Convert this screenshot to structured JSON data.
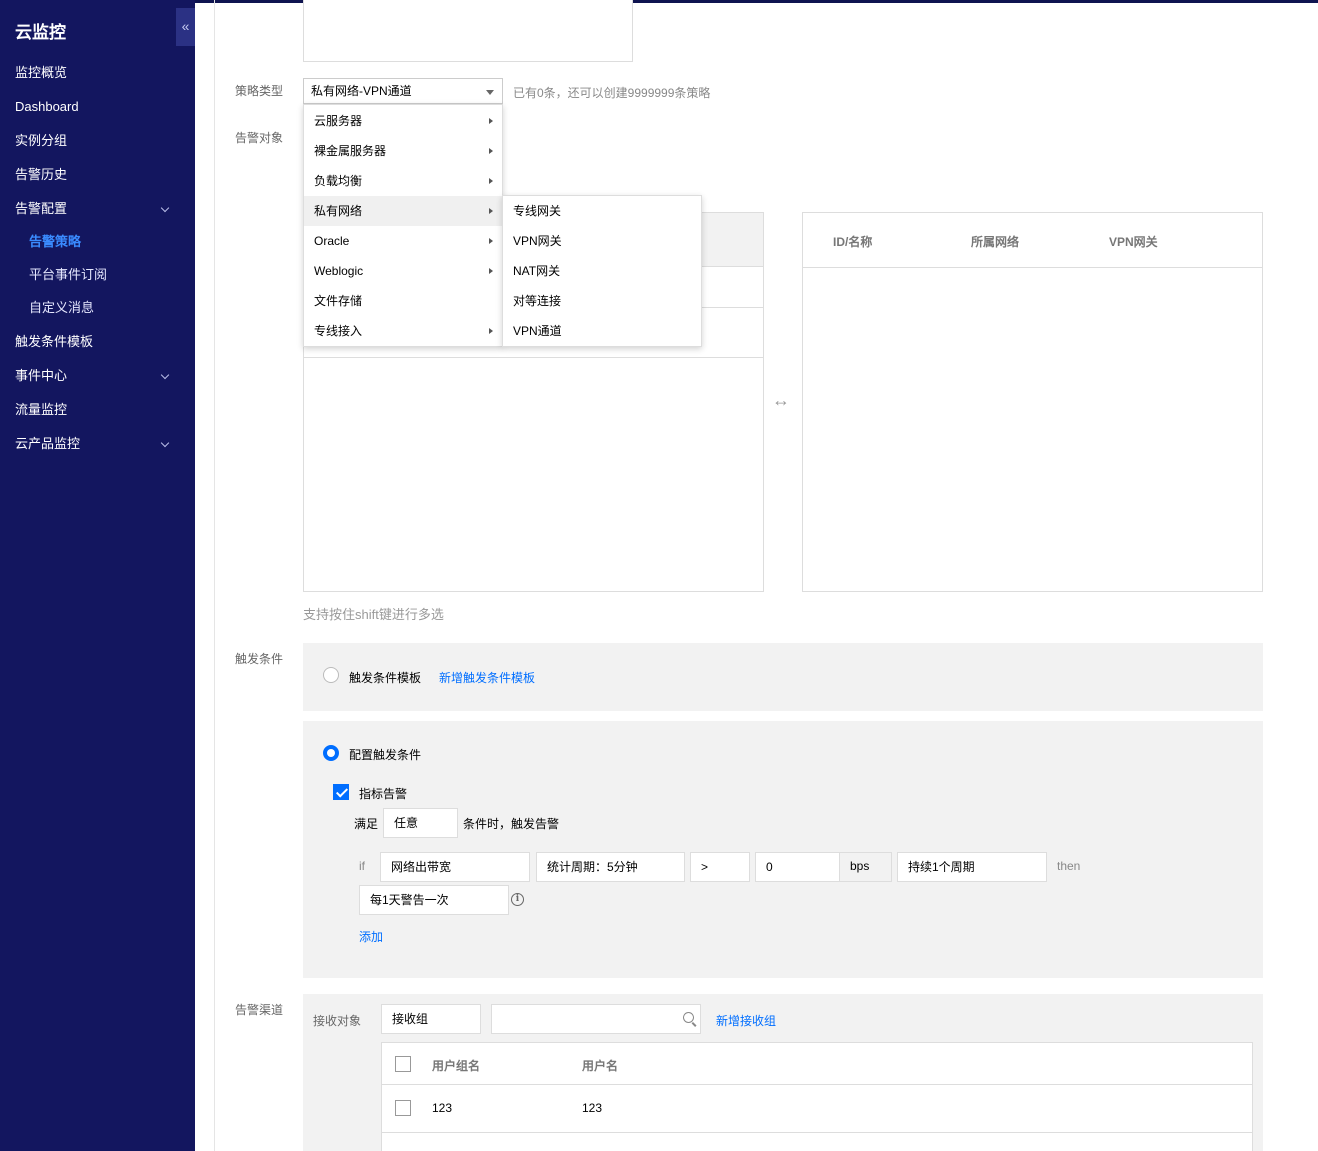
{
  "sidebar": {
    "title": "云监控",
    "collapse_glyph": "«",
    "items": [
      {
        "label": "监控概览"
      },
      {
        "label": "Dashboard"
      },
      {
        "label": "实例分组"
      },
      {
        "label": "告警历史"
      },
      {
        "label": "告警配置",
        "expandable": true
      },
      {
        "label": "告警策略",
        "sub": true,
        "active": true
      },
      {
        "label": "平台事件订阅",
        "sub": true
      },
      {
        "label": "自定义消息",
        "sub": true
      },
      {
        "label": "触发条件模板"
      },
      {
        "label": "事件中心",
        "expandable": true
      },
      {
        "label": "流量监控"
      },
      {
        "label": "云产品监控",
        "expandable": true
      }
    ]
  },
  "form": {
    "policy_type_label": "策略类型",
    "policy_type_value": "私有网络-VPN通道",
    "policy_type_hint": "已有0条，还可以创建9999999条策略",
    "alarm_object_label": "告警对象",
    "trigger_label": "触发条件",
    "channel_label": "告警渠道"
  },
  "dropdown": {
    "items": [
      {
        "label": "云服务器",
        "has_sub": true
      },
      {
        "label": "裸金属服务器",
        "has_sub": true
      },
      {
        "label": "负载均衡",
        "has_sub": true
      },
      {
        "label": "私有网络",
        "has_sub": true,
        "highlighted": true
      },
      {
        "label": "Oracle",
        "has_sub": true
      },
      {
        "label": "Weblogic",
        "has_sub": true
      },
      {
        "label": "文件存储",
        "has_sub": false
      },
      {
        "label": "专线接入",
        "has_sub": true
      }
    ],
    "submenu": [
      {
        "label": "专线网关"
      },
      {
        "label": "VPN网关"
      },
      {
        "label": "NAT网关"
      },
      {
        "label": "对等连接"
      },
      {
        "label": "VPN通道"
      }
    ]
  },
  "selected_table": {
    "headers": [
      "ID/名称",
      "所属网络",
      "VPN网关"
    ]
  },
  "transfer_icon": "↔",
  "multi_select_hint": "支持按住shift键进行多选",
  "trigger": {
    "template_option": "触发条件模板",
    "template_checked": false,
    "new_template_link": "新增触发条件模板",
    "config_option": "配置触发条件",
    "config_checked": true,
    "metric_alarm_label": "指标告警",
    "metric_alarm_checked": true,
    "satisfy_prefix": "满足",
    "satisfy_value": "任意",
    "satisfy_suffix": "条件时，触发告警",
    "if_label": "if",
    "metric": "网络出带宽",
    "period": "统计周期：5分钟",
    "operator": ">",
    "threshold": "0",
    "unit": "bps",
    "duration": "持续1个周期",
    "then_label": "then",
    "frequency": "每1天警告一次",
    "add_link": "添加"
  },
  "channel": {
    "receiver_label": "接收对象",
    "receiver_select": "接收组",
    "search_value": "",
    "new_group_link": "新增接收组",
    "table_headers": [
      "用户组名",
      "用户名"
    ],
    "rows": [
      {
        "group": "123",
        "user": "123"
      }
    ]
  },
  "colors": {
    "sidebar_bg": "#13165f",
    "accent": "#006eff",
    "active_nav": "#3a8bff"
  }
}
